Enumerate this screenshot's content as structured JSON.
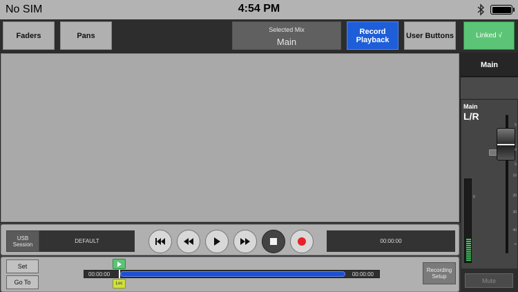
{
  "status_bar": {
    "carrier": "No SIM",
    "time": "4:54 PM",
    "battery_level": 1.0
  },
  "toolbar": {
    "faders_label": "Faders",
    "pans_label": "Pans",
    "selected_mix_label": "Selected Mix",
    "selected_mix_value": "Main",
    "record_playback_label": "Record Playback",
    "user_buttons_label": "User Buttons",
    "linked_label": "Linked √"
  },
  "channel_strip": {
    "name": "Main",
    "title_top": "Main",
    "title_main": "L/R",
    "meter_zero_label": "0",
    "fader_scale": [
      "5",
      "0",
      "5",
      "10",
      "20",
      "30",
      "40",
      "∞"
    ],
    "mute_label": "Mute",
    "meter_level": 0.28
  },
  "transport": {
    "usb_session_label": "USB Session",
    "session_name": "DEFAULT",
    "time": "00:00:00"
  },
  "locator": {
    "set_label": "Set",
    "goto_label": "Go To",
    "start_time": "00:00:00",
    "end_time": "00:00:00",
    "loc_label": "Loc",
    "recording_setup_label": "Recording Setup"
  },
  "colors": {
    "accent_blue": "#1e5ed8",
    "linked_green": "#5cc476",
    "record_red": "#e8202a",
    "locator_yellow": "#cfe038"
  }
}
